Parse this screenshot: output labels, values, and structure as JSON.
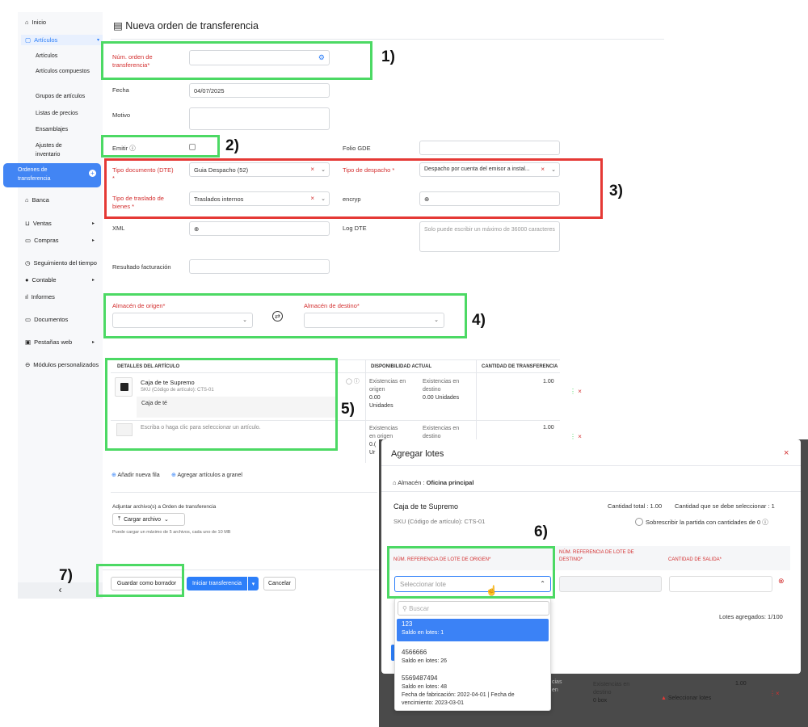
{
  "sidebar": {
    "inicio": "Inicio",
    "articulos_group": "Artículos",
    "sub_items": [
      "Artículos",
      "Artículos compuestos",
      "Grupos de artículos",
      "Listas de precios",
      "Ensamblajes",
      "Ajustes de inventario"
    ],
    "active_item": "Ordenes de transferencia",
    "banca": "Banca",
    "ventas": "Ventas",
    "compras": "Compras",
    "seguimiento": "Seguimiento del tiempo",
    "contable": "Contable",
    "informes": "Informes",
    "documentos": "Documentos",
    "pestanas": "Pestañas web",
    "modulos": "Módulos personalizados",
    "collapse": "‹"
  },
  "page": {
    "title": "Nueva orden de transferencia"
  },
  "form": {
    "num_orden_label": "Núm. orden de transferencia*",
    "fecha_label": "Fecha",
    "fecha_value": "04/07/2025",
    "motivo_label": "Motivo",
    "emitir_label": "Emitir",
    "folio_label": "Folio GDE",
    "tipo_doc_label": "Tipo documento (DTE) *",
    "tipo_doc_value": "Guia Despacho (52)",
    "tipo_despacho_label": "Tipo de despacho *",
    "tipo_despacho_value": "Despacho por cuenta del emisor a instal...",
    "tipo_traslado_label": "Tipo de traslado de bienes *",
    "tipo_traslado_value": "Traslados internos",
    "encryp_label": "encryp",
    "xml_label": "XML",
    "log_label": "Log DTE",
    "log_placeholder": "Solo puede escribir un máximo de 36000 caracteres",
    "resultado_label": "Resultado facturación",
    "origen_label": "Almacén de origen*",
    "destino_label": "Almacén de destino*"
  },
  "table": {
    "col_detalles": "DETALLES DEL ARTÍCULO",
    "col_disponibilidad": "DISPONIBILIDAD ACTUAL",
    "col_cantidad": "CANTIDAD DE TRANSFERENCIA",
    "row1_name": "Caja de te Supremo",
    "row1_sku": "SKU (Código de artículo): CTS-01",
    "row1_desc": "Caja de té",
    "row1_exist_origen_label": "Existencias en origen",
    "row1_exist_origen_value": "0.00",
    "row1_exist_origen_unit": "Unidades",
    "row1_exist_destino_label": "Existencias en destino",
    "row1_exist_destino_value": "0.00 Unidades",
    "row1_qty": "1.00",
    "row2_placeholder": "Escriba o haga clic para seleccionar un artículo.",
    "row2_exist_origen_label": "Existencias en origen",
    "row2_exist_origen_value": "0.(",
    "row2_exist_origen_unit": "Ur",
    "row2_exist_destino_label": "Existencias en destino",
    "row2_qty": "1.00",
    "add_row": "Añadir nueva fila",
    "add_bulk": "Agregar artículos a granel"
  },
  "attachments": {
    "label": "Adjuntar archivo(s) a Orden de transferencia",
    "upload": "Cargar archivo",
    "hint": "Puede cargar un máximo de 5 archivos, cada uno de 10 MB"
  },
  "footer": {
    "save_draft": "Guardar como borrador",
    "start": "Iniciar transferencia",
    "cancel": "Cancelar"
  },
  "annotations": [
    "1)",
    "2)",
    "3)",
    "4)",
    "5)",
    "6)",
    "7)"
  ],
  "modal": {
    "title": "Agregar lotes",
    "warehouse_label": "Almacén :",
    "warehouse_value": "Oficina principal",
    "item_name": "Caja de te Supremo",
    "item_sku": "SKU (Código de artículo): CTS-01",
    "qty_total": "Cantidad total : 1.00",
    "qty_select": "Cantidad que se debe seleccionar : 1",
    "overwrite": "Sobrescribir la partida con cantidades de 0",
    "col_origen": "NÚM. REFERENCIA DE LOTE DE ORIGEN*",
    "col_destino": "NÚM. REFERENCIA DE LOTE DE DESTINO*",
    "col_salida": "CANTIDAD DE SALIDA*",
    "select_placeholder": "Seleccionar lote",
    "search_placeholder": "Buscar",
    "added": "Lotes agregados: 1/100",
    "options": [
      {
        "lote": "123",
        "saldo": "Saldo en lotes: 1"
      },
      {
        "lote": "4566666",
        "saldo": "Saldo en lotes: 26"
      },
      {
        "lote": "5569487494",
        "saldo": "Saldo en lotes: 48",
        "extra": "Fecha de fabricación: 2022-04-01",
        "extra2": "Fecha de vencimiento: 2023-03-01"
      }
    ]
  },
  "background_row": {
    "cias": "cias",
    "en": "en",
    "x": "x",
    "destino_label": "Existencias en destino",
    "destino_value": "0 box",
    "select_lots": "Seleccionar lotes",
    "qty": "1.00"
  }
}
